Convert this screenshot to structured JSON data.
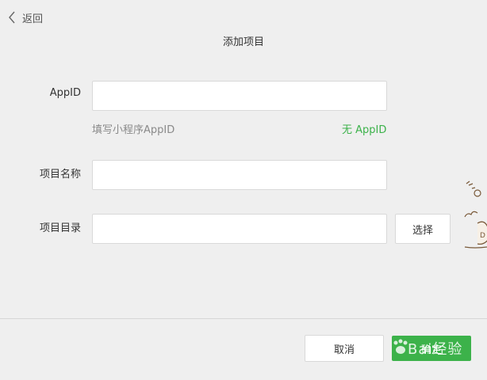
{
  "header": {
    "back_label": "返回",
    "title": "添加项目"
  },
  "form": {
    "appid": {
      "label": "AppID",
      "value": "",
      "hint": "填写小程序AppID",
      "no_appid_link": "无 AppID"
    },
    "project_name": {
      "label": "项目名称",
      "value": ""
    },
    "project_dir": {
      "label": "项目目录",
      "value": "",
      "choose_label": "选择"
    }
  },
  "footer": {
    "cancel_label": "取消",
    "confirm_label": "确定"
  },
  "watermark": {
    "text": "Bai经验"
  },
  "colors": {
    "background": "#efefef",
    "accent": "#3cb24a",
    "border": "#d9d9d9",
    "hint": "#8a8a8a"
  }
}
